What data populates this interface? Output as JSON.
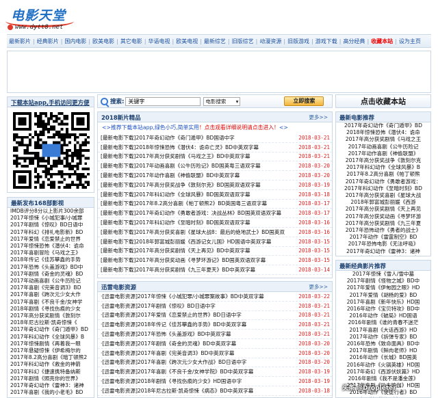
{
  "site": {
    "logo_text": "电影天堂",
    "logo_url": "www.dytt8.net"
  },
  "nav": {
    "items": [
      "最新影片",
      "经典影片",
      "国内电影",
      "欧美电影",
      "其它电影",
      "华语电视",
      "欧美电视",
      "最新综艺",
      "旧版综艺",
      "动漫资源",
      "旧版游戏",
      "游戏下载",
      "高分经典"
    ],
    "hot": "收藏本站",
    "home": "设为主页"
  },
  "search": {
    "label": "搜索:",
    "value": "关键字",
    "select": "电影搜索",
    "button": "立即搜索"
  },
  "collect": {
    "label": "点击收藏本站"
  },
  "app_panel": {
    "title": "下载本站app,手机访问更方便"
  },
  "left_list": {
    "title": "最新发布168部影视",
    "items": [
      "IMDB评分8分以上影片300余部",
      "2017年惊悚《小城犯事/小城罪",
      "2017年剧情《惊叹》BD日语中",
      "2017年科幻《排礼电影新》BD",
      "2017年爱情《恋爱禁止的世界",
      "2017年惊悚恐怖《潜伏4：诡命",
      "2017年喜剧冒险《马戏之王》",
      "2018年传记《佳苏攀鑫的手势",
      "2017年恐怖《头盖游戏》BD中",
      "2017年剧情《奇金的灵魂》BD",
      "2017年动画喜剧《公牛历险记",
      "2017年喜剧《完美音调3》BD",
      "2017年喜剧《跨次元少女大作",
      "2017年喜剧《不良千金/女神学",
      "2018年剧情《寻找伤痕的少女",
      "2017年高分获奖剧情《敦刻尔",
      "2018年尼古拉斯·凯奇惊悚《",
      "2017年奇幻动作《奇门遁甲》BD",
      "2017年科幻动作《全球风暴》B",
      "2017年惊悚剧情《再着我一眼",
      "2017年悬疑惊悚《伊希梅尔的",
      "2017年8.2高分喜剧《暗丁顿熊2",
      "2017年科幻动作《救金的神箭",
      "2017年科幻《捷速携特备纳斯",
      "2017年剧情《照亮你的世界》",
      "2017年奇幻动作《雷神3：诸神",
      "2017年喜剧《我的小老毛》BD"
    ]
  },
  "new_movies": {
    "title": "2018新片精品",
    "more": "更多>>",
    "promo_prefix": "<>推荐下载本站app,绿色小巧,简单实用",
    "promo_red": "！点击观看详细说明请点击进入！",
    "promo_suffix": "<>",
    "rows": [
      {
        "title": "[最新电影下载]2017年奇幻动作《奇门遁甲》BD国语中字",
        "date": "2018-03-21"
      },
      {
        "title": "[最新电影下载]2018年惊悚恐怖《潜伏4：诡命亡灵》BD中英双字幕",
        "date": "2018-03-21"
      },
      {
        "title": "[最新电影下载]2017年高分获奖剧情《马戏之王》BD中英双字幕",
        "date": "2018-03-21"
      },
      {
        "title": "[最新电影下载]2017年动画喜剧《公牛历险记》BD国英粤三语双字幕",
        "date": "2018-03-20"
      },
      {
        "title": "[最新电影下载]2017年动作喜剧《神偷联盟》BD中英双字幕",
        "date": "2018-03-20"
      },
      {
        "title": "[最新电影下载]2017年高分获奖战争《敦刻尔克》BD国英双语双字幕",
        "date": "2018-03-19"
      },
      {
        "title": "[最新电影下载]2017年科幻动作《全球风暴》BD国英双语双字幕",
        "date": "2018-03-18"
      },
      {
        "title": "[最新电影下载]2017年8.2高分喜剧《帕丁顿熊2》BD英国粤三语双字幕",
        "date": "2018-03-17"
      },
      {
        "title": "[最新电影下载]2017年奇幻动作《勇敢者游戏：决战丛林》BD国英双语双字幕",
        "date": "2018-03-17"
      },
      {
        "title": "[最新电影下载]2017年科幻动作《至暗时刻》BD国英双语双字幕",
        "date": "2018-03-16"
      },
      {
        "title": "[最新电影下载]2017年高分获奖喜剧《星球大战8：最后的绝地武士》BD国英双",
        "date": "2018-03-16"
      },
      {
        "title": "[最新电影下载]2018年郭富城彭丽媛《西游记女儿国》HD国语中英双字幕",
        "date": "2018-03-15"
      },
      {
        "title": "[最新电影下载]2017年高分获奖剧情《天上再见》BD中英双字幕",
        "date": "2018-03-15"
      },
      {
        "title": "[最新电影下载]2017年高分获奖动画《寻梦环游记》BD国英双语双字幕",
        "date": "2018-03-15"
      },
      {
        "title": "[最新电影下载]2017年高分获奖剧情《九三年夏天》BD中英双字幕",
        "date": "2018-03-14"
      }
    ]
  },
  "xunlei": {
    "title": "迅雷电影资源",
    "more": "更多>>",
    "rows": [
      {
        "title": "·[迅雷电影资源]2017年惊悚《小城犯罪/小城罪案故事》BD中英双字幕",
        "date": "2018-03-22"
      },
      {
        "title": "·[迅雷电影资源]2017年剧情《惊叹》BD日语中字",
        "date": "2018-03-21"
      },
      {
        "title": "·[迅雷电影资源]2017年爱情《恋爱禁止的世界》BD日语中字",
        "date": "2018-03-21"
      },
      {
        "title": "·[迅雷电影资源]2018年传记《佳苏攀鑫的手势》BD中英双字幕",
        "date": "2018-03-21"
      },
      {
        "title": "·[迅雷电影资源]2017年恐怖《头盖游戏》BD中英双字幕",
        "date": "2018-03-21"
      },
      {
        "title": "·[迅雷电影资源]2017年剧情《奇金的灵魂》BD中英双字幕",
        "date": "2018-03-20"
      },
      {
        "title": "·[迅雷电影资源]2017年喜剧《完美音调3》BD中英双字幕",
        "date": "2018-03-20"
      },
      {
        "title": "·[迅雷电影资源]2017年喜剧《跨次元少女大作战》BD日语中字",
        "date": "2018-03-20"
      },
      {
        "title": "·[迅雷电影资源]2017年喜剧《不良千金/女神学院》BD中英双字幕",
        "date": "2018-03-19"
      },
      {
        "title": "·[迅雷电影资源]2018年剧情《寻找伤痕的少女》HD国语中字",
        "date": "2018-03-19"
      },
      {
        "title": "·[迅雷电影资源]2018年尼古拉斯·凯奇惊悚《病态》BD中英双字幕",
        "date": "2018-03-18"
      }
    ]
  },
  "right_latest": {
    "title": "最新电影推荐",
    "items": [
      "2017年奇幻动作《奇门遁甲》BD",
      "2018年惊悚恐怖《潜伏4：诡命",
      "2017年高分获奖剧情《马戏之王",
      "2017年动画喜剧《公牛历险记",
      "2017年动作喜剧《神偷联盟》",
      "2017年高分获奖战争《敦刻尔克",
      "2017年科幻动作《全球风暴》B",
      "2017年8.2高分喜剧《帕丁顿熊",
      "2017年奇幻动作《勇敢者游戏：",
      "2017年科幻动作《至暗时刻》BD",
      "2017年高分获奖喜剧《星球大战",
      "2018年郭富城彭丽媛《西游",
      "2017年高分获奖剧情《天上再见",
      "2017年高分获奖动画《寻梦环游",
      "2017年高分获奖剧情《九三年夏",
      "2017年恐怖动作《勇者的战士》",
      "2017年动作《雷霆制空》BD",
      "2017年恐怖电影《无法呼吸》",
      "2017年奇幻动作《雷神3：诸神",
      "2017年科幻《银翼杀手2049》"
    ]
  },
  "right_classic": {
    "title": "最新经典影片推荐",
    "items": [
      "2017年惊悚《雪人/雪中墓",
      "2017年剧情《怪物之城》BD中",
      "2017年爱情《伊甸园之眼》HD",
      "2017年爱情《胡杨的爱》BD",
      "2017年喜剧《新年快乐》HD国",
      "2016年动作《宝贝特攻》BD中",
      "2016年动作《破局》HD国语",
      "2016年剧情《谁的青春不迷茫",
      "2017年喜剧《大话西游》HD",
      "2017年动作《拆弹专家》BD",
      "2016年恐怖《致命面具》BD中",
      "2017年剧情《鲜肉老师》HD",
      "2016年动作《长城》BD国英",
      "2016年动作《火锅英雄》HD国",
      "2017年奇幻《西游伏妖篇》HD",
      "2016年剧情《我不是潘金莲》",
      "2017年喜剧《功夫瑜伽》HD国",
      "2016年动作《使徒行者》BD",
      "2017年剧情《嫌疑人》HD国语",
      "2017年科幻《机器之血》HD国"
    ]
  },
  "watermark": "头条 @Dropleter"
}
